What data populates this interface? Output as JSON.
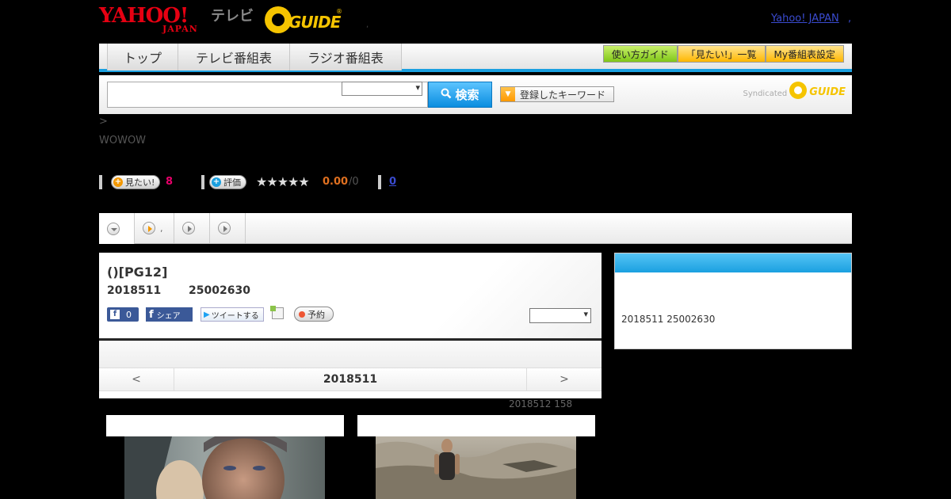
{
  "header": {
    "yahoo_logo_top": "YAHOO!",
    "yahoo_logo_bottom": "JAPAN",
    "tv_label": "テレビ",
    "gguide_logo": "GUIDE",
    "gguide_reg": "®",
    "separator": ",",
    "yahoo_japan_link": "Yahoo! JAPAN",
    "yahoo_japan_suffix": ","
  },
  "nav": {
    "tabs": [
      "トップ",
      "テレビ番組表",
      "ラジオ番組表"
    ],
    "buttons": [
      "使い方ガイド",
      "「見たい!」一覧",
      "My番組表設定"
    ]
  },
  "search": {
    "button_label": "検索",
    "keyword_button": "登録したキーワード",
    "syndicated_label": "Syndicated",
    "syndicated_logo": "GUIDE"
  },
  "breadcrumb": ">",
  "channel": "WOWOW",
  "ratings": {
    "mitai_label": "見たい!",
    "mitai_count": "8",
    "hyoka_label": "評価",
    "stars": "★★★★★",
    "score": "0.00",
    "score_count": "/0",
    "link_count": "0"
  },
  "tabstrip": {
    "item2_label": ","
  },
  "program": {
    "title": "()[PG12]",
    "date": "2018511",
    "id": "25002630",
    "fb_count": "0",
    "fb_letter": "f",
    "share_label": "シェア",
    "tweet_label": "ツイートする",
    "yoyaku_label": "予約"
  },
  "date_nav": {
    "prev": "<",
    "current": "2018511",
    "next": ">"
  },
  "updated_text": "2018512  158",
  "sidebar": {
    "info": "2018511  25002630"
  }
}
